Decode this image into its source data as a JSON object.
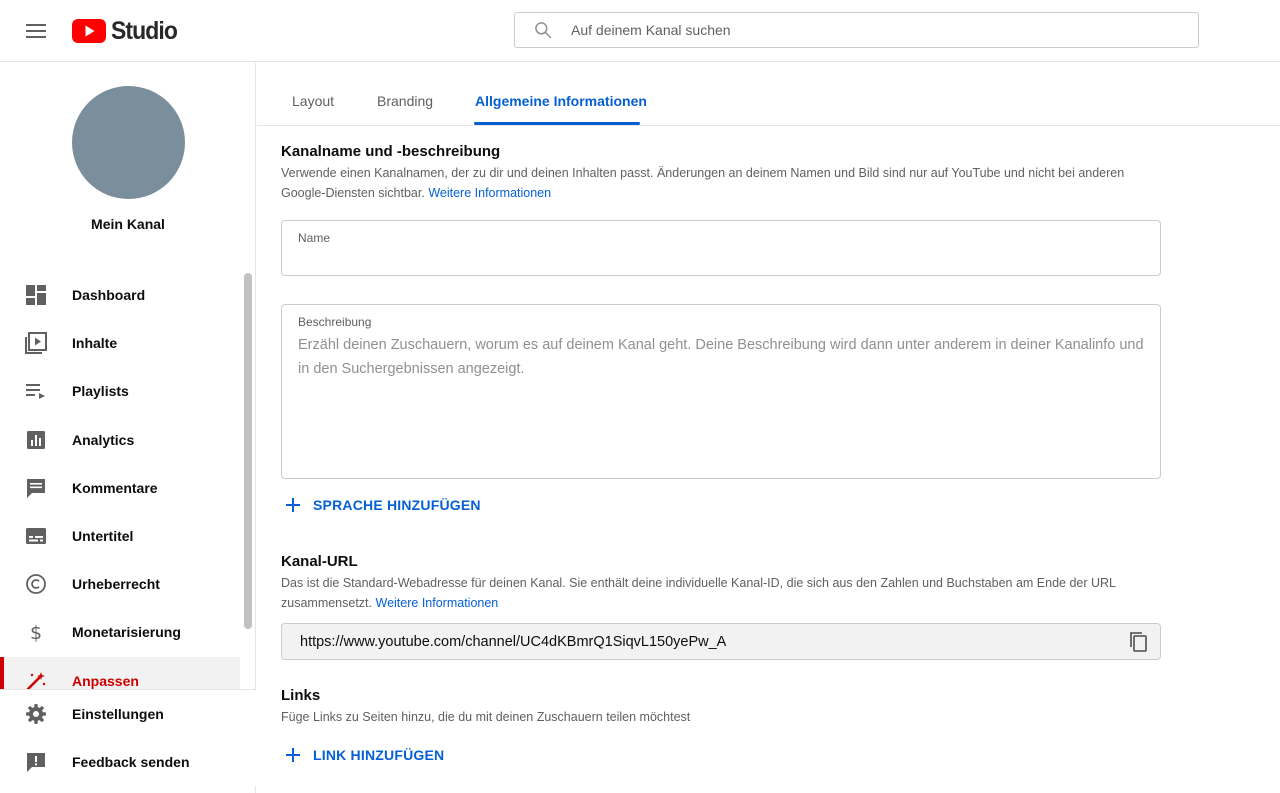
{
  "header": {
    "logo_text": "Studio",
    "search_placeholder": "Auf deinem Kanal suchen"
  },
  "sidebar": {
    "channel_name": "Mein Kanal",
    "items": [
      {
        "label": "Dashboard",
        "icon": "dashboard-icon"
      },
      {
        "label": "Inhalte",
        "icon": "content-icon"
      },
      {
        "label": "Playlists",
        "icon": "playlist-icon"
      },
      {
        "label": "Analytics",
        "icon": "analytics-icon"
      },
      {
        "label": "Kommentare",
        "icon": "comments-icon"
      },
      {
        "label": "Untertitel",
        "icon": "subtitles-icon"
      },
      {
        "label": "Urheberrecht",
        "icon": "copyright-icon"
      },
      {
        "label": "Monetarisierung",
        "icon": "dollar-icon"
      },
      {
        "label": "Anpassen",
        "icon": "magic-wand-icon",
        "active": true
      }
    ],
    "bottom_items": [
      {
        "label": "Einstellungen",
        "icon": "gear-icon"
      },
      {
        "label": "Feedback senden",
        "icon": "feedback-icon"
      }
    ]
  },
  "tabs": [
    {
      "label": "Layout"
    },
    {
      "label": "Branding"
    },
    {
      "label": "Allgemeine Informationen",
      "active": true
    }
  ],
  "name_section": {
    "title": "Kanalname und -beschreibung",
    "description": "Verwende einen Kanalnamen, der zu dir und deinen Inhalten passt. Änderungen an deinem Namen und Bild sind nur auf YouTube und nicht bei anderen Google-Diensten sichtbar.",
    "link": "Weitere Informationen",
    "name_label": "Name",
    "name_value": "",
    "description_label": "Beschreibung",
    "description_placeholder": "Erzähl deinen Zuschauern, worum es auf deinem Kanal geht. Deine Beschreibung wird dann unter anderem in deiner Kanalinfo und in den Suchergebnissen angezeigt.",
    "add_language": "SPRACHE HINZUFÜGEN"
  },
  "url_section": {
    "title": "Kanal-URL",
    "description": "Das ist die Standard-Webadresse für deinen Kanal. Sie enthält deine individuelle Kanal-ID, die sich aus den Zahlen und Buchstaben am Ende der URL zusammensetzt.",
    "link": "Weitere Informationen",
    "url": "https://www.youtube.com/channel/UC4dKBmrQ1SiqvL150yePw_A"
  },
  "links_section": {
    "title": "Links",
    "description": "Füge Links zu Seiten hinzu, die du mit deinen Zuschauern teilen möchtest",
    "add_link": "LINK HINZUFÜGEN"
  },
  "colors": {
    "youtube_red": "#ff0000",
    "accent_blue": "#065fd4",
    "active_red": "#cc0000",
    "avatar": "#7a8f9b"
  }
}
